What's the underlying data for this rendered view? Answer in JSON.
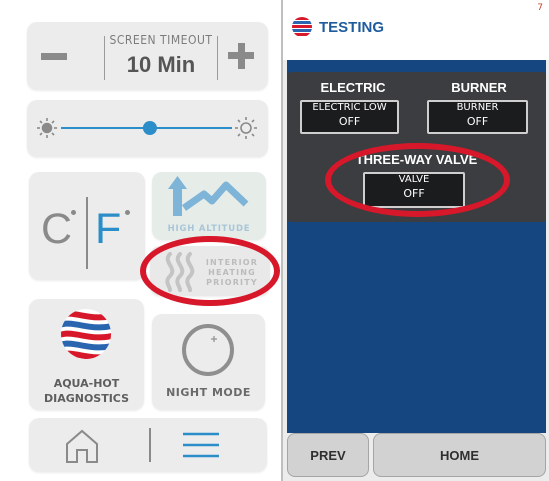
{
  "left_panel": {
    "screen_timeout": {
      "label": "SCREEN TIMEOUT",
      "value": "10 Min"
    },
    "units": {
      "celsius": "C",
      "fahrenheit": "F"
    },
    "high_altitude": {
      "label": "HIGH ALTITUDE"
    },
    "interior_heating_priority": {
      "line1": "INTERIOR",
      "line2": "HEATING",
      "line3": "PRIORITY"
    },
    "aqua_hot": {
      "line1": "AQUA-HOT",
      "line2": "DIAGNOSTICS"
    },
    "night_mode": {
      "label": "NIGHT MODE"
    },
    "brightness": {
      "level": 0.52
    },
    "nav": {
      "home_icon": "home-icon",
      "menu_icon": "menu-icon"
    }
  },
  "right_panel": {
    "header": {
      "title": "TESTING",
      "page_number": "7"
    },
    "section_electric": {
      "heading": "ELECTRIC",
      "button": {
        "label": "ELECTRIC LOW",
        "state": "OFF"
      }
    },
    "section_burner": {
      "heading": "BURNER",
      "button": {
        "label": "BURNER",
        "state": "OFF"
      }
    },
    "section_valve": {
      "heading": "THREE-WAY VALVE",
      "button": {
        "label": "VALVE",
        "state": "OFF"
      }
    },
    "footer": {
      "prev": "PREV",
      "home": "HOME"
    }
  },
  "colors": {
    "accent_blue": "#2c8ec8",
    "panel_navy": "#16467f",
    "highlight_red": "#d7182a"
  }
}
